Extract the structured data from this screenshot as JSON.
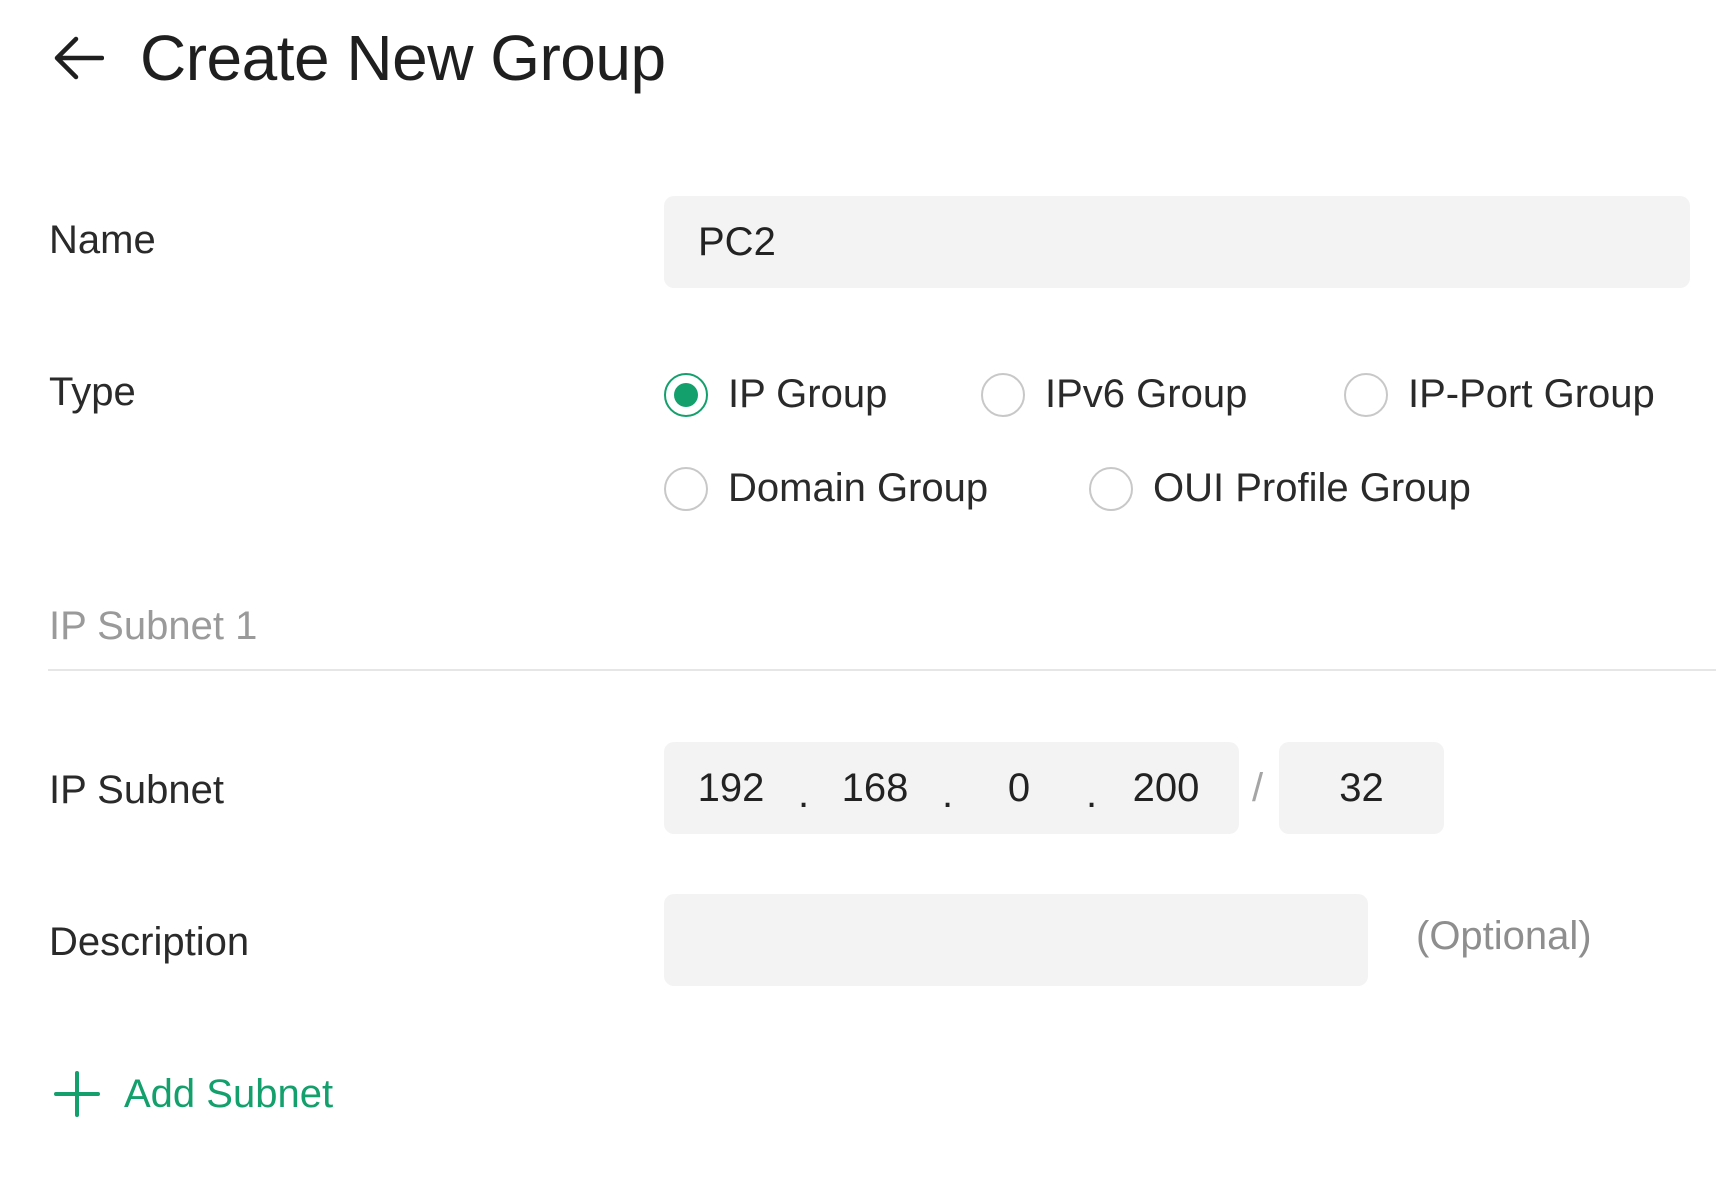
{
  "header": {
    "back_icon": "arrow-left-icon",
    "title": "Create New Group"
  },
  "form": {
    "name": {
      "label": "Name",
      "value": "PC2"
    },
    "type": {
      "label": "Type",
      "selected": "IP Group",
      "options": [
        {
          "label": "IP Group",
          "checked": true
        },
        {
          "label": "IPv6 Group",
          "checked": false
        },
        {
          "label": "IP-Port Group",
          "checked": false
        },
        {
          "label": "Domain Group",
          "checked": false
        },
        {
          "label": "OUI Profile Group",
          "checked": false
        }
      ]
    },
    "section": {
      "title": "IP Subnet 1"
    },
    "ip_subnet": {
      "label": "IP Subnet",
      "octets": [
        "192",
        "168",
        "0",
        "200"
      ],
      "separator": ".",
      "mask_separator": "/",
      "mask": "32"
    },
    "description": {
      "label": "Description",
      "value": "",
      "hint": "(Optional)"
    },
    "add_subnet": {
      "icon": "plus-icon",
      "label": "Add Subnet"
    }
  },
  "colors": {
    "accent": "#13a06c",
    "input_bg": "#f3f3f3",
    "muted_text": "#9a9a9a",
    "divider": "#e6e6e6"
  }
}
